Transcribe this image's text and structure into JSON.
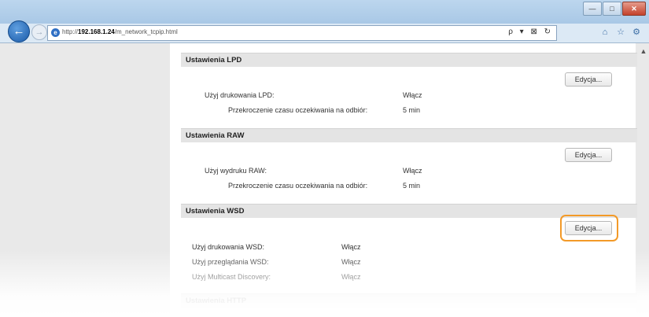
{
  "browser": {
    "url_prefix": "http://",
    "url_host": "192.168.1.24",
    "url_path": "/m_network_tcpip.html",
    "address_tools": "ρ ▾ ⊠ ↻",
    "window_buttons": {
      "minimize": "—",
      "maximize": "□",
      "close": "✕"
    },
    "nav_icons": [
      "⌂",
      "☆",
      "⚙"
    ]
  },
  "sections": {
    "lpd": {
      "title": "Ustawienia LPD",
      "edit_label": "Edycja...",
      "row1_label": "Użyj drukowania LPD:",
      "row1_value": "Włącz",
      "row2_label": "Przekroczenie czasu oczekiwania na odbiór:",
      "row2_value": "5 min"
    },
    "raw": {
      "title": "Ustawienia RAW",
      "edit_label": "Edycja...",
      "row1_label": "Użyj wydruku RAW:",
      "row1_value": "Włącz",
      "row2_label": "Przekroczenie czasu oczekiwania na odbiór:",
      "row2_value": "5 min"
    },
    "wsd": {
      "title": "Ustawienia WSD",
      "edit_label": "Edycja...",
      "row1_label": "Użyj drukowania WSD:",
      "row1_value": "Włącz",
      "row2_label": "Użyj przeglądania WSD:",
      "row2_value": "Włącz",
      "row3_label": "Użyj Multicast Discovery:",
      "row3_value": "Włącz"
    },
    "http": {
      "title": "Ustawienia HTTP"
    }
  },
  "colors": {
    "highlight": "#f39a28",
    "section_header_bg": "#e4e4e4",
    "title_bar": "#bcd6ee"
  }
}
